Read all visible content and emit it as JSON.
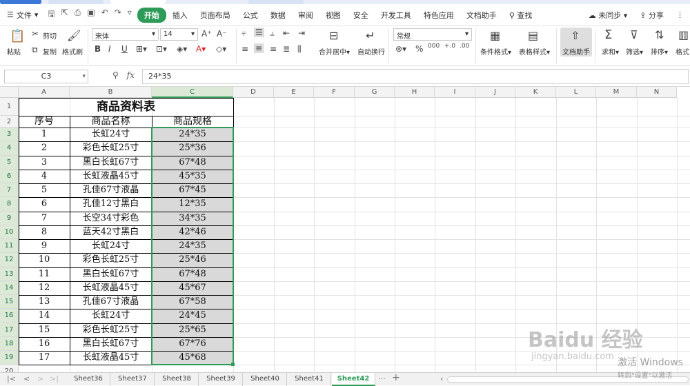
{
  "menubar": {
    "file_label": "文件",
    "tabs": [
      "开始",
      "插入",
      "页面布局",
      "公式",
      "数据",
      "审阅",
      "视图",
      "安全",
      "开发工具",
      "特色应用",
      "文档助手"
    ],
    "active_tab": "开始",
    "search_label": "查找",
    "sync_label": "未同步",
    "share_label": "分享"
  },
  "ribbon": {
    "paste": "粘贴",
    "cut": "剪切",
    "copy": "复制",
    "format_painter": "格式刷",
    "font_name": "宋体",
    "font_size": "14",
    "merge_center": "合并居中",
    "wrap_text": "自动换行",
    "number_format": "常规",
    "conditional_format": "条件格式",
    "table_style": "表格样式",
    "doc_assistant": "文档助手",
    "sum": "求和",
    "filter": "筛选",
    "sort": "排序",
    "format": "格式"
  },
  "formula_bar": {
    "cell_ref": "C3",
    "fx": "fx",
    "value": "24*35"
  },
  "grid": {
    "columns": [
      "A",
      "B",
      "C",
      "D",
      "E",
      "F",
      "G",
      "H",
      "I",
      "J",
      "K",
      "L",
      "M",
      "N"
    ],
    "rows": [
      "1",
      "2",
      "3",
      "4",
      "5",
      "6",
      "7",
      "8",
      "9",
      "10",
      "11",
      "12",
      "13",
      "14",
      "15",
      "16",
      "17",
      "18",
      "19",
      "20"
    ],
    "title": "商品资料表",
    "headers": [
      "序号",
      "商品名称",
      "商品规格"
    ],
    "data": [
      [
        "1",
        "长虹24寸",
        "24*35"
      ],
      [
        "2",
        "彩色长虹25寸",
        "25*36"
      ],
      [
        "3",
        "黑白长虹67寸",
        "67*48"
      ],
      [
        "4",
        "长虹液晶45寸",
        "45*35"
      ],
      [
        "5",
        "孔佳67寸液晶",
        "67*45"
      ],
      [
        "6",
        "孔佳12寸黑白",
        "12*35"
      ],
      [
        "7",
        "长空34寸彩色",
        "34*35"
      ],
      [
        "8",
        "蓝天42寸黑白",
        "42*46"
      ],
      [
        "9",
        "长虹24寸",
        "24*35"
      ],
      [
        "10",
        "彩色长虹25寸",
        "25*46"
      ],
      [
        "11",
        "黑白长虹67寸",
        "67*48"
      ],
      [
        "12",
        "长虹液晶45寸",
        "45*67"
      ],
      [
        "13",
        "孔佳67寸液晶",
        "67*58"
      ],
      [
        "14",
        "长虹24寸",
        "24*45"
      ],
      [
        "15",
        "彩色长虹25寸",
        "25*65"
      ],
      [
        "16",
        "黑白长虹67寸",
        "67*76"
      ],
      [
        "17",
        "长虹液晶45寸",
        "45*68"
      ]
    ]
  },
  "sheet_tabs": {
    "tabs": [
      "Sheet36",
      "Sheet37",
      "Sheet38",
      "Sheet39",
      "Sheet40",
      "Sheet41",
      "Sheet42"
    ],
    "active": "Sheet42",
    "more": "···",
    "add": "+"
  },
  "watermark": {
    "brand": "Baidu 经验",
    "url": "jingyan.baidu.com",
    "activate_windows": "激活 Windows",
    "activate_hint": "转到\"设置\"以激活"
  },
  "colors": {
    "accent": "#2e9c58",
    "selection_fill": "#d9d9d9"
  }
}
